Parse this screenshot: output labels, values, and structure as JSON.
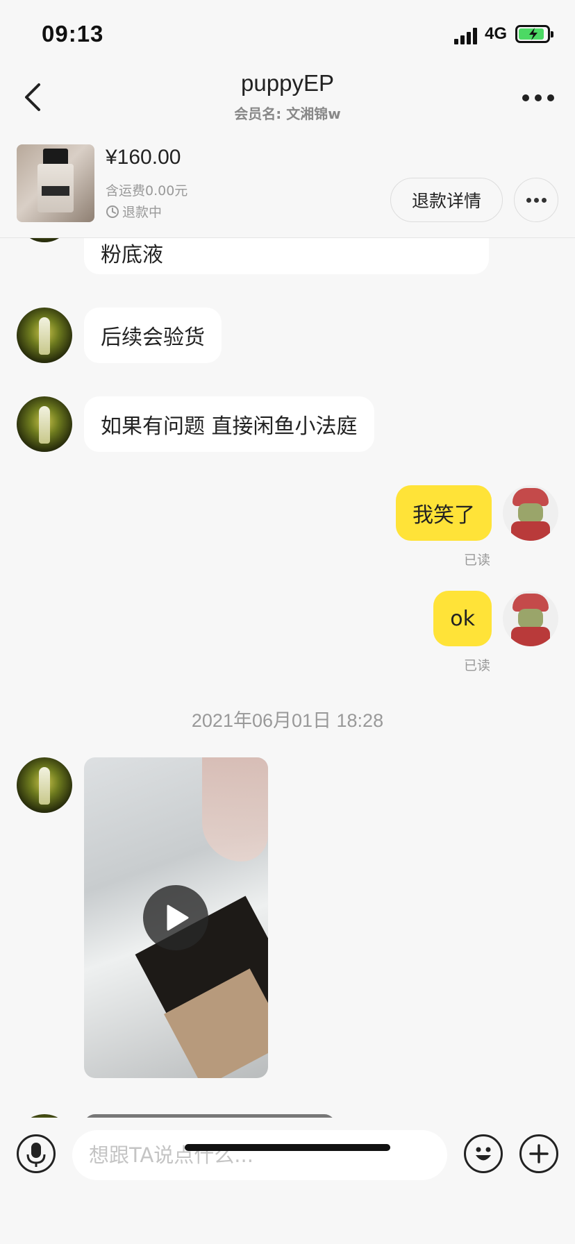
{
  "status_bar": {
    "time": "09:13",
    "network": "4G"
  },
  "header": {
    "title": "puppyEP",
    "member_label": "会员名: 文湘锦w"
  },
  "product": {
    "price": "¥160.00",
    "shipping": "含运费0.00元",
    "status": "退款中",
    "refund_detail_label": "退款详情"
  },
  "messages": [
    {
      "side": "left",
      "text": "粉底液"
    },
    {
      "side": "left",
      "text": "后续会验货"
    },
    {
      "side": "left",
      "text": "如果有问题 直接闲鱼小法庭"
    },
    {
      "side": "right",
      "text": "我笑了",
      "read": "已读"
    },
    {
      "side": "right",
      "text": "ok",
      "read": "已读"
    },
    {
      "timestamp": "2021年06月01日 18:28"
    },
    {
      "side": "left",
      "type": "video"
    }
  ],
  "input": {
    "placeholder": "想跟TA说点什么..."
  },
  "colors": {
    "self_bubble": "#ffe338",
    "other_bubble": "#ffffff",
    "background": "#f7f7f7",
    "battery": "#4cd964"
  },
  "icons": [
    "back-icon",
    "more-icon",
    "clock-icon",
    "play-icon",
    "microphone-icon",
    "emoji-icon",
    "plus-icon",
    "signal-icon",
    "battery-icon"
  ]
}
